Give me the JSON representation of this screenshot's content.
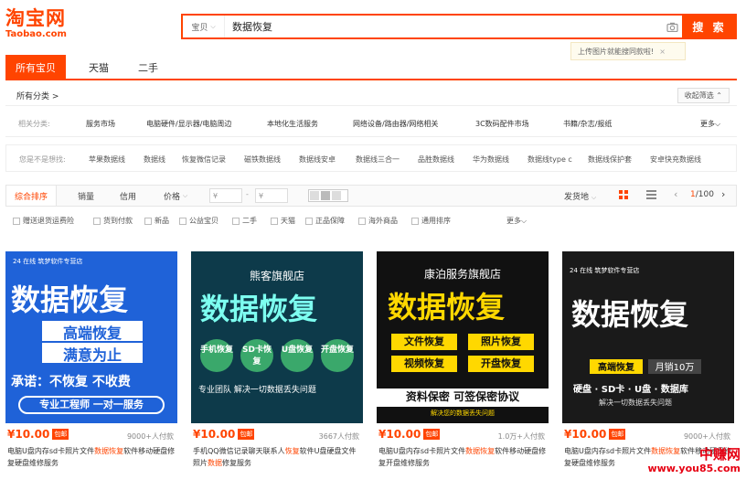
{
  "logo": {
    "cn": "淘宝网",
    "en": "Taobao.com"
  },
  "search": {
    "scope": "宝贝",
    "query": "数据恢复",
    "button": "搜 索"
  },
  "tooltip": {
    "text": "上传图片就能搜同款啦!",
    "close": "×"
  },
  "tabs": [
    {
      "label": "所有宝贝",
      "active": true
    },
    {
      "label": "天猫"
    },
    {
      "label": "二手"
    }
  ],
  "breadcrumb": {
    "label": "所有分类",
    "collapse": "收起筛选"
  },
  "related": {
    "label": "相关分类:",
    "items": [
      "服务市场",
      "电脑硬件/显示器/电脑周边",
      "本地化生活服务",
      "网络设备/路由器/网络相关",
      "3C数码配件市场",
      "书籍/杂志/报纸"
    ],
    "more": "更多"
  },
  "guess": {
    "label": "您是不是想找:",
    "items": [
      "苹果数据线",
      "数据线",
      "恢复微信记录",
      "磁铁数据线",
      "数据线安卓",
      "数据线三合一",
      "品胜数据线",
      "华为数据线",
      "数据线type c",
      "数据线保护套",
      "安卓快充数据线"
    ]
  },
  "sort": {
    "items": [
      "综合排序",
      "销量",
      "信用",
      "价格"
    ],
    "price_from": "¥",
    "price_to": "¥",
    "ship": "发货地",
    "page": "1",
    "total": "/100"
  },
  "filters": [
    "赠送退货运费险",
    "货到付款",
    "新品",
    "公益宝贝",
    "二手",
    "天猫",
    "正品保障",
    "海外商品",
    "通用排序"
  ],
  "filters_more": "更多",
  "products": [
    {
      "price": "¥10.00",
      "badge": "包邮",
      "buyers": "9000+人付款",
      "title_a": "电脑U盘内存sd卡照片文件",
      "title_hl": "数据恢复",
      "title_b": "软件移动硬盘修复硬盘维修服务",
      "img": {
        "store": "24 在线 筑梦软件专营店",
        "big": "数据恢复",
        "l1": "高端恢复",
        "l2": "满意为止",
        "promise": "承诺：不恢复 不收费",
        "team": "专业工程师 一对一服务"
      }
    },
    {
      "price": "¥10.00",
      "badge": "包邮",
      "buyers": "3667人付款",
      "title_a": "手机QQ微信记录聊天联系人",
      "title_hl": "恢复",
      "title_b": "软件U盘硬盘文件照片",
      "title_hl2": "数据",
      "title_c": "修复服务",
      "img": {
        "store": "熊客旗舰店",
        "big": "数据恢复",
        "c1": "手机恢复",
        "c2": "SD卡恢复",
        "c3": "U盘恢复",
        "c4": "开盘恢复",
        "bottom": "专业团队 解决一切数据丢失问题"
      }
    },
    {
      "price": "¥10.00",
      "badge": "包邮",
      "buyers": "1.0万+人付款",
      "title_a": "电脑U盘内存sd卡照片文件",
      "title_hl": "数据恢复",
      "title_b": "软件移动硬盘修复开盘维修服务",
      "img": {
        "store": "康泊服务旗舰店",
        "big": "数据恢复",
        "b1": "文件恢复",
        "b2": "照片恢复",
        "b3": "视频恢复",
        "b4": "开盘恢复",
        "bottom": "资料保密 可签保密协议",
        "sub": "解决您的数据丢失问题"
      }
    },
    {
      "price": "¥10.00",
      "badge": "包邮",
      "buyers": "9000+人付款",
      "title_a": "电脑U盘内存sd卡照片文件",
      "title_hl": "数据恢复",
      "title_b": "软件移动硬盘修复硬盘维修服务",
      "img": {
        "store": "24 在线 筑梦软件专营店",
        "big": "数据恢复",
        "tag1": "高端恢复",
        "tag2": "月销10万",
        "line": "硬盘 · SD卡 · U盘 · 数据库",
        "bottom": "解决一切数据丢失问题"
      }
    }
  ],
  "watermark": {
    "cn": "中赚网",
    "url": "www.you85.com"
  },
  "colors": {
    "accent": "#ff4400",
    "blue": "#2e6fe0",
    "dark": "#1a1a1a",
    "yellow": "#ffd800"
  }
}
